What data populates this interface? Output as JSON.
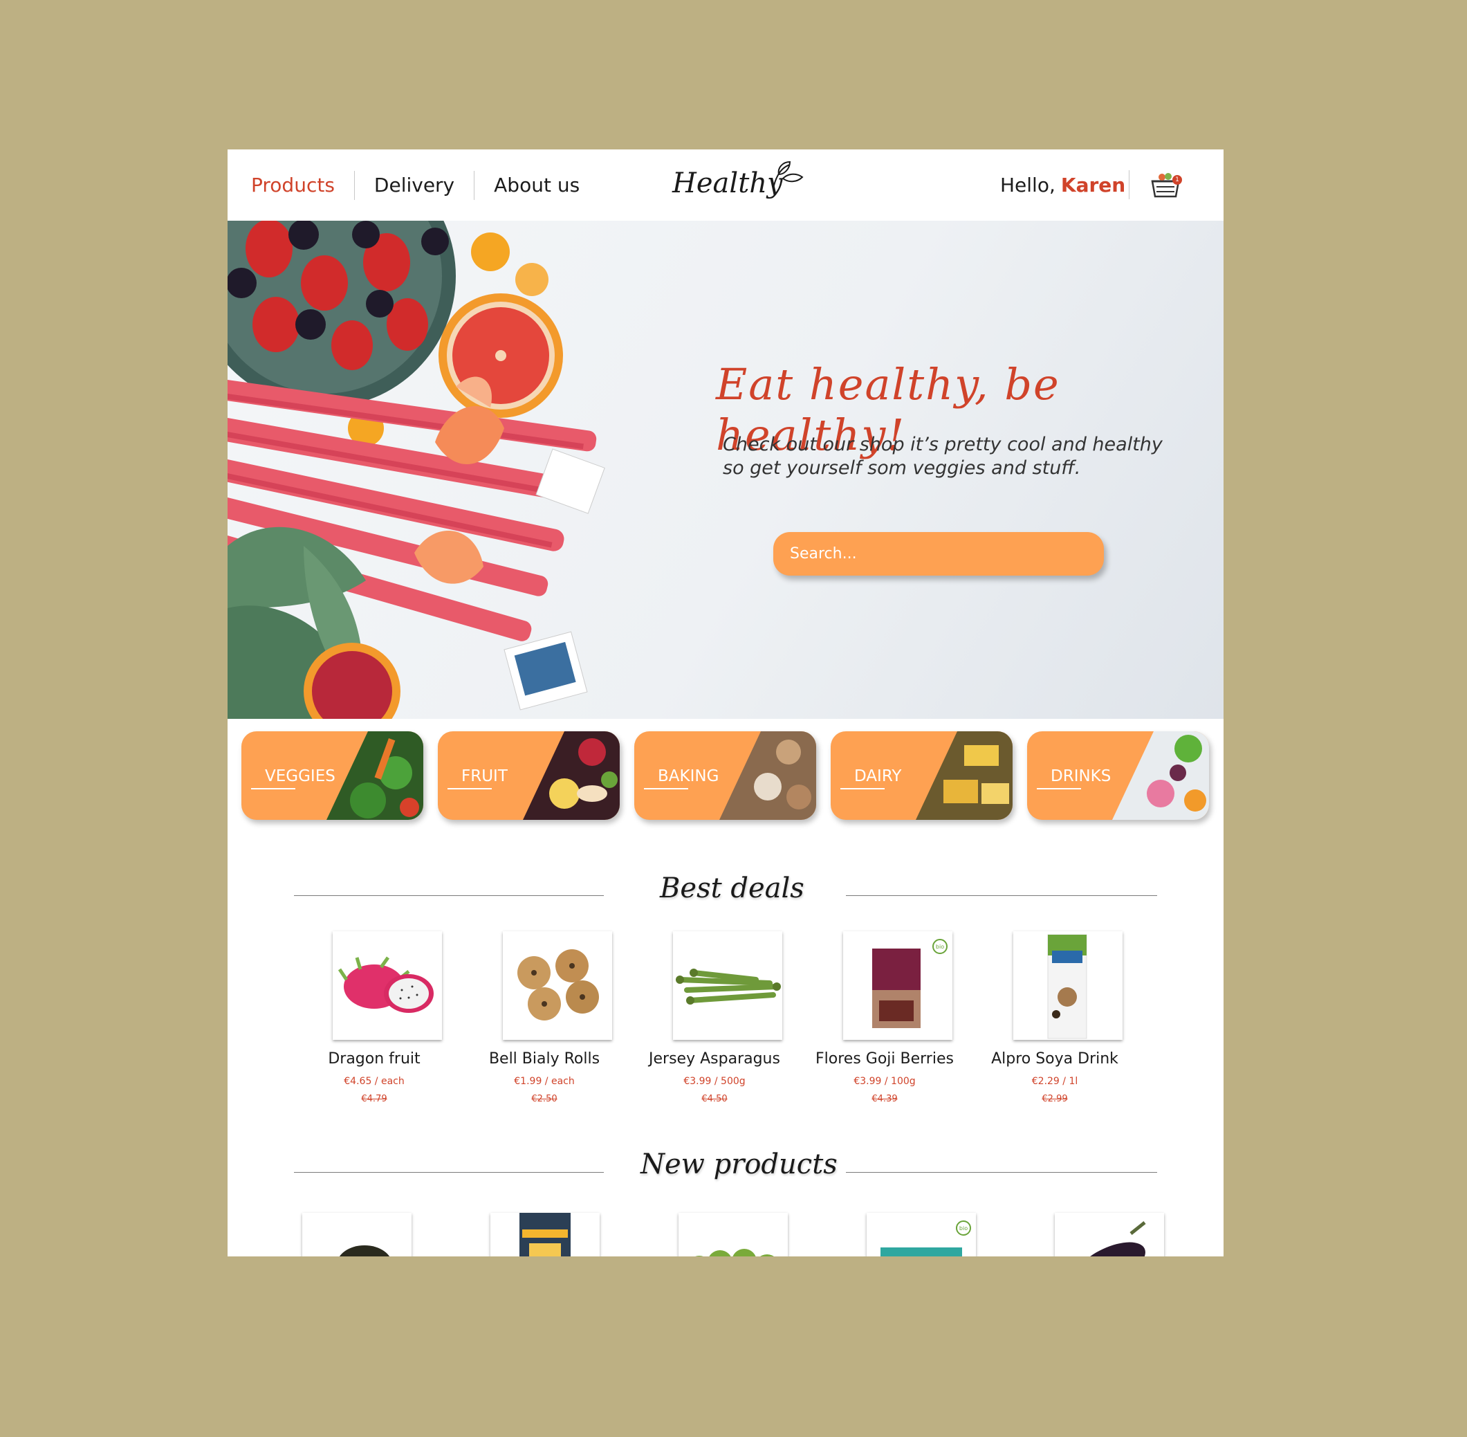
{
  "header": {
    "nav": [
      "Products",
      "Delivery",
      "About us"
    ],
    "logo_text": "Healthy",
    "greeting": "Hello,",
    "user_name": "Karen",
    "cart_count": "1"
  },
  "hero": {
    "title": "Eat healthy, be healthy!",
    "subtitle": "Check out our shop it’s pretty cool and healthy so get yourself som veggies and stuff.",
    "search_placeholder": "Search..."
  },
  "categories": [
    "VEGGIES",
    "FRUIT",
    "BAKING",
    "DAIRY",
    "DRINKS"
  ],
  "best_deals": {
    "title": "Best deals",
    "products": [
      {
        "name": "Dragon fruit",
        "price": "€4.65 / each",
        "old_price": "€4.79"
      },
      {
        "name": "Bell Bialy Rolls",
        "price": "€1.99 / each",
        "old_price": "€2.50"
      },
      {
        "name": "Jersey Asparagus",
        "price": "€3.99 / 500g",
        "old_price": "€4.50"
      },
      {
        "name": "Flores Goji Berries",
        "price": "€3.99 / 100g",
        "old_price": "€4.39"
      },
      {
        "name": "Alpro Soya Drink",
        "price": "€2.29 / 1l",
        "old_price": "€2.99"
      }
    ]
  },
  "new_products": {
    "title": "New products"
  },
  "badges": {
    "bio": "bio"
  },
  "colors": {
    "accent": "#d0432a",
    "orange": "#fea152",
    "background": "#bdb083"
  }
}
